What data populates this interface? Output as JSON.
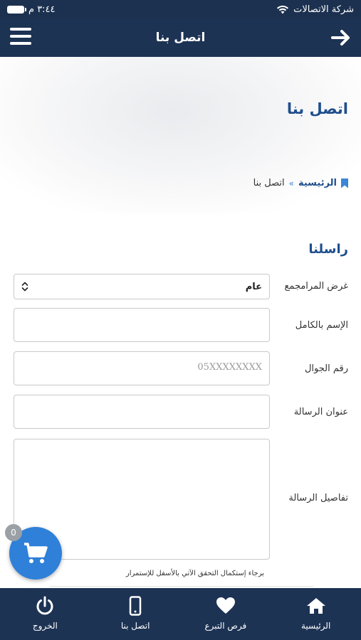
{
  "status_bar": {
    "carrier": "شركة الاتصالات",
    "time": "٣:٤٤ م"
  },
  "app_bar": {
    "title": "اتصل بنا"
  },
  "hero": {
    "title": "اتصل بنا"
  },
  "breadcrumb": {
    "home": "الرئيسية",
    "separator": "»",
    "current": "اتصل بنا"
  },
  "form": {
    "section_title": "راسلنا",
    "purpose_label": "غرض المرامجمع",
    "purpose_value": "عام",
    "fullname_label": "الإسم بالكامل",
    "mobile_label": "رقم الجوال",
    "mobile_placeholder": "05XXXXXXXX",
    "subject_label": "عنوان الرسالة",
    "details_label": "تفاصيل الرسالة",
    "captcha_hint": "برجاء إستكمال التحقق الآتي بالأسفل للإستمرار"
  },
  "cart": {
    "count": "0",
    "icon": "cart-icon"
  },
  "bottom_nav": {
    "items": [
      {
        "label": "الرئيسية",
        "icon": "home-icon"
      },
      {
        "label": "فرص التبرع",
        "icon": "heart-icon"
      },
      {
        "label": "اتصل بنا",
        "icon": "phone-icon"
      },
      {
        "label": "الخروج",
        "icon": "power-icon"
      }
    ]
  },
  "colors": {
    "header_bg": "#1d3354",
    "accent": "#1f4e8c",
    "cart_button": "#2f80d8"
  }
}
